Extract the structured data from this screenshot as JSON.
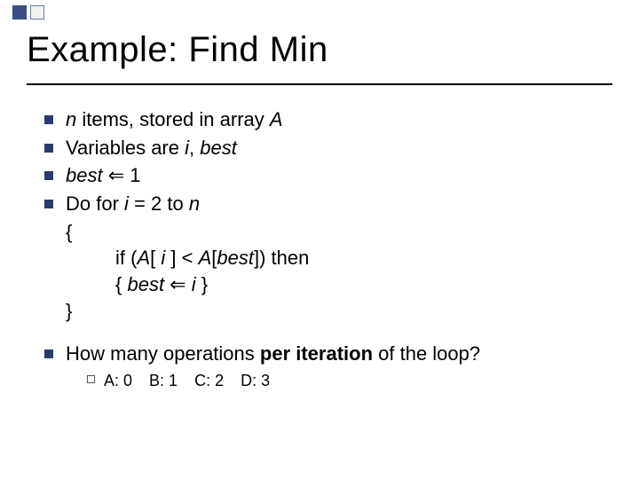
{
  "title": "Example: Find Min",
  "bullets": {
    "b1_pre": "n",
    "b1_mid": " items, stored in array ",
    "b1_post": "A",
    "b2_pre": "Variables are ",
    "b2_i": "i",
    "b2_sep": ", ",
    "b2_best": "best",
    "b3_best": "best",
    "b3_arrow": " ⇐ ",
    "b3_val": "1",
    "b4_pre": "Do for ",
    "b4_i": "i",
    "b4_mid": " = 2 to ",
    "b4_n": "n"
  },
  "code": {
    "open": "{",
    "if_pre": "if (",
    "if_A1": "A",
    "if_br1": "[ ",
    "if_i": "i",
    "if_br2": " ] < ",
    "if_A2": "A",
    "if_br3": "[",
    "if_best": "best",
    "if_br4": "]) then",
    "assign_open": "{ ",
    "assign_best": "best",
    "assign_arrow": " ⇐ ",
    "assign_i": "i",
    "assign_close": " }",
    "close": "}"
  },
  "question": {
    "pre": "How many operations ",
    "bold": "per iteration",
    "post": " of the loop?"
  },
  "choices": {
    "a": "A: 0",
    "b": "B: 1",
    "c": "C: 2",
    "d": "D: 3"
  }
}
